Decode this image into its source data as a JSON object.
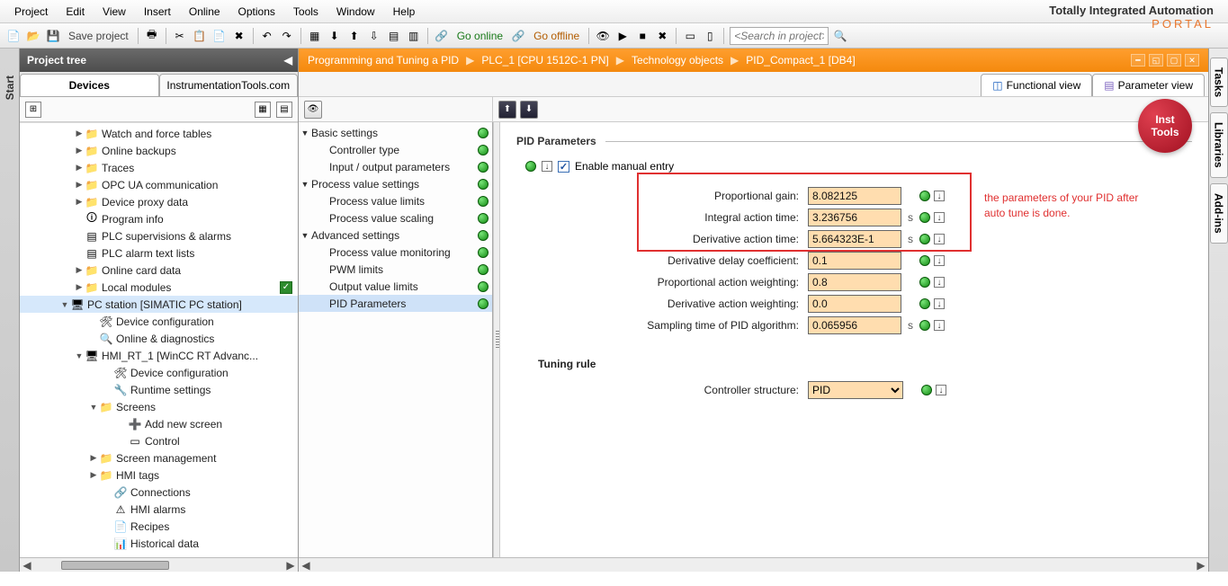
{
  "brand": {
    "title": "Totally Integrated Automation",
    "subtitle": "PORTAL"
  },
  "menubar": [
    "Project",
    "Edit",
    "View",
    "Insert",
    "Online",
    "Options",
    "Tools",
    "Window",
    "Help"
  ],
  "toolbar": {
    "save_label": "Save project",
    "go_online": "Go online",
    "go_offline": "Go offline",
    "search_placeholder": "<Search in project>"
  },
  "left_rail": {
    "label": "Start"
  },
  "project_tree": {
    "title": "Project tree",
    "tabs": [
      "Devices",
      "InstrumentationTools.com"
    ],
    "items": [
      {
        "indent": 60,
        "exp": "▶",
        "icon": "folder",
        "label": "Watch and force tables"
      },
      {
        "indent": 60,
        "exp": "▶",
        "icon": "folder",
        "label": "Online backups"
      },
      {
        "indent": 60,
        "exp": "▶",
        "icon": "folder",
        "label": "Traces"
      },
      {
        "indent": 60,
        "exp": "▶",
        "icon": "folder",
        "label": "OPC UA communication"
      },
      {
        "indent": 60,
        "exp": "▶",
        "icon": "folder",
        "label": "Device proxy data"
      },
      {
        "indent": 60,
        "exp": "",
        "icon": "info",
        "label": "Program info"
      },
      {
        "indent": 60,
        "exp": "",
        "icon": "doc",
        "label": "PLC supervisions & alarms"
      },
      {
        "indent": 60,
        "exp": "",
        "icon": "doc",
        "label": "PLC alarm text lists"
      },
      {
        "indent": 60,
        "exp": "▶",
        "icon": "folder",
        "label": "Online card data"
      },
      {
        "indent": 60,
        "exp": "▶",
        "icon": "folder",
        "label": "Local modules",
        "check": true
      },
      {
        "indent": 44,
        "exp": "▼",
        "icon": "device",
        "label": "PC station [SIMATIC PC station]",
        "sel": true
      },
      {
        "indent": 76,
        "exp": "",
        "icon": "devcfg",
        "label": "Device configuration"
      },
      {
        "indent": 76,
        "exp": "",
        "icon": "diag",
        "label": "Online & diagnostics"
      },
      {
        "indent": 60,
        "exp": "▼",
        "icon": "hmi",
        "label": "HMI_RT_1 [WinCC RT Advanc..."
      },
      {
        "indent": 92,
        "exp": "",
        "icon": "devcfg",
        "label": "Device configuration"
      },
      {
        "indent": 92,
        "exp": "",
        "icon": "tool",
        "label": "Runtime settings"
      },
      {
        "indent": 76,
        "exp": "▼",
        "icon": "folder",
        "label": "Screens"
      },
      {
        "indent": 108,
        "exp": "",
        "icon": "add",
        "label": "Add new screen"
      },
      {
        "indent": 108,
        "exp": "",
        "icon": "screen",
        "label": "Control"
      },
      {
        "indent": 76,
        "exp": "▶",
        "icon": "folder",
        "label": "Screen management"
      },
      {
        "indent": 76,
        "exp": "▶",
        "icon": "folder",
        "label": "HMI tags"
      },
      {
        "indent": 92,
        "exp": "",
        "icon": "conn",
        "label": "Connections"
      },
      {
        "indent": 92,
        "exp": "",
        "icon": "alarm",
        "label": "HMI alarms"
      },
      {
        "indent": 92,
        "exp": "",
        "icon": "recipe",
        "label": "Recipes"
      },
      {
        "indent": 92,
        "exp": "",
        "icon": "hist",
        "label": "Historical data"
      }
    ]
  },
  "breadcrumb": [
    "Programming and Tuning a PID",
    "PLC_1 [CPU 1512C-1 PN]",
    "Technology objects",
    "PID_Compact_1 [DB4]"
  ],
  "view_tabs": {
    "functional": "Functional view",
    "parameter": "Parameter view"
  },
  "logo": {
    "line1": "Inst",
    "line2": "Tools"
  },
  "settings_nav": [
    {
      "indent": 0,
      "exp": "▼",
      "label": "Basic settings"
    },
    {
      "indent": 20,
      "exp": "",
      "label": "Controller type"
    },
    {
      "indent": 20,
      "exp": "",
      "label": "Input / output parameters"
    },
    {
      "indent": 0,
      "exp": "▼",
      "label": "Process value settings"
    },
    {
      "indent": 20,
      "exp": "",
      "label": "Process value limits"
    },
    {
      "indent": 20,
      "exp": "",
      "label": "Process value scaling"
    },
    {
      "indent": 0,
      "exp": "▼",
      "label": "Advanced settings"
    },
    {
      "indent": 20,
      "exp": "",
      "label": "Process value monitoring"
    },
    {
      "indent": 20,
      "exp": "",
      "label": "PWM limits"
    },
    {
      "indent": 20,
      "exp": "",
      "label": "Output value limits"
    },
    {
      "indent": 20,
      "exp": "",
      "label": "PID Parameters",
      "sel": true
    }
  ],
  "pid_section": {
    "title": "PID Parameters",
    "enable_label": "Enable manual entry",
    "params": [
      {
        "label": "Proportional gain:",
        "value": "8.082125",
        "unit": ""
      },
      {
        "label": "Integral action time:",
        "value": "3.236756",
        "unit": "s"
      },
      {
        "label": "Derivative action time:",
        "value": "5.664323E-1",
        "unit": "s"
      },
      {
        "label": "Derivative delay coefficient:",
        "value": "0.1",
        "unit": ""
      },
      {
        "label": "Proportional action weighting:",
        "value": "0.8",
        "unit": ""
      },
      {
        "label": "Derivative action weighting:",
        "value": "0.0",
        "unit": ""
      },
      {
        "label": "Sampling time of PID algorithm:",
        "value": "0.065956",
        "unit": "s"
      }
    ],
    "tuning_rule_title": "Tuning rule",
    "controller_structure_label": "Controller structure:",
    "controller_structure_value": "PID",
    "annotation": "the parameters of your PID after auto tune is done."
  },
  "right_rail": [
    "Tasks",
    "Libraries",
    "Add-ins"
  ]
}
